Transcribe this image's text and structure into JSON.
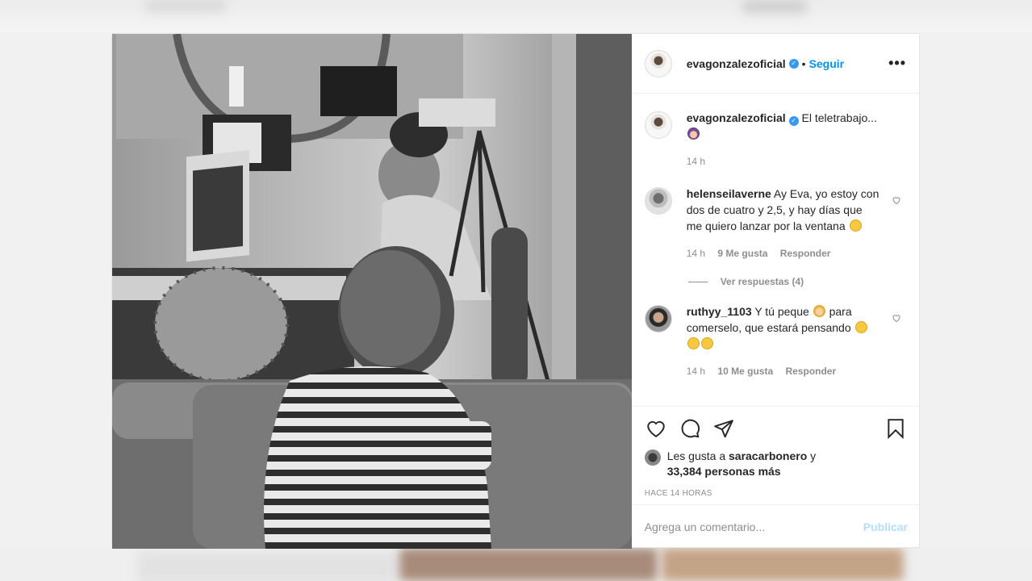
{
  "post": {
    "author": "evagonzalezoficial",
    "follow_label": "Seguir",
    "dot": "•",
    "more_label": "•••",
    "caption": {
      "user": "evagonzalezoficial",
      "text": "El teletrabajo...",
      "time": "14 h"
    },
    "comments": [
      {
        "user": "helenseilaverne",
        "text": "Ay Eva, yo estoy con dos de cuatro y 2,5, y hay días que me quiero lanzar por la ventana",
        "time": "14 h",
        "likes": "9 Me gusta",
        "reply": "Responder"
      },
      {
        "user": "ruthyy_1103",
        "text_a": "Y tú peque",
        "text_b": "para comerselo, que estará pensando",
        "time": "14 h",
        "likes": "10 Me gusta",
        "reply": "Responder"
      }
    ],
    "view_replies": "Ver respuestas (4)",
    "likes_prefix": "Les gusta a",
    "likes_user": "saracarbonero",
    "likes_suffix": "y",
    "likes_count": "33,384 personas más",
    "posted_ago": "HACE 14 HORAS",
    "comment_placeholder": "Agrega un comentario...",
    "publish_label": "Publicar"
  },
  "colors": {
    "accent": "#0095f6",
    "publish_disabled": "#b2dffc",
    "verified": "#3897f0"
  }
}
